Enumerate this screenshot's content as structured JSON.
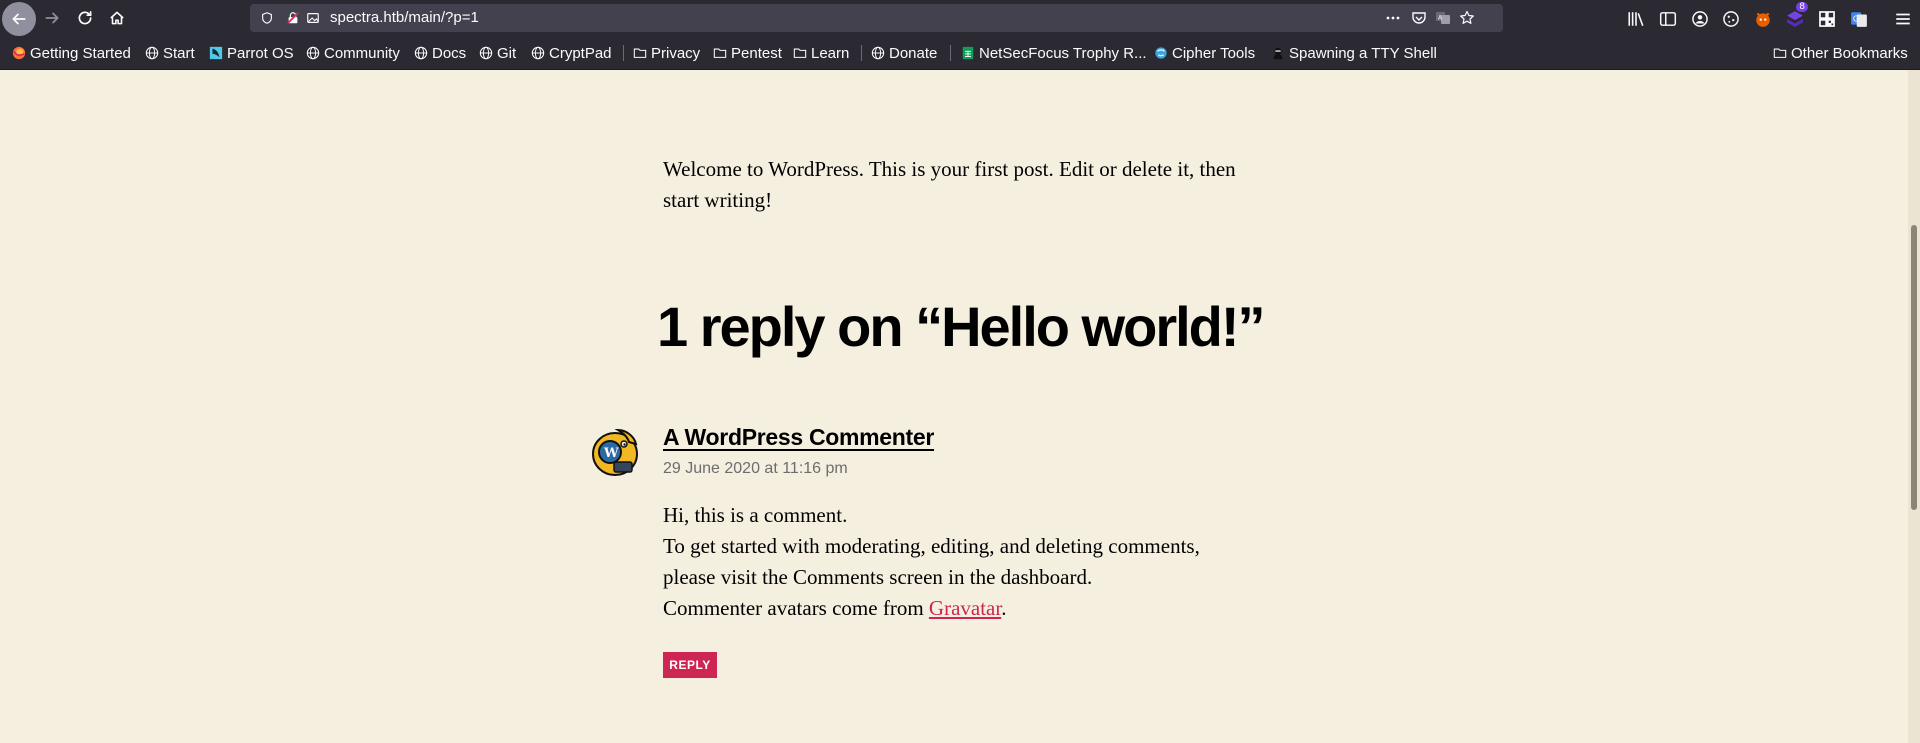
{
  "browser": {
    "url": "spectra.htb/main/?p=1",
    "bookmarks": [
      {
        "label": "Getting Started",
        "icon": "firefox-icon"
      },
      {
        "label": "Start",
        "icon": "globe-icon"
      },
      {
        "label": "Parrot OS",
        "icon": "parrot-icon"
      },
      {
        "label": "Community",
        "icon": "globe-icon"
      },
      {
        "label": "Docs",
        "icon": "globe-icon"
      },
      {
        "label": "Git",
        "icon": "globe-icon"
      },
      {
        "label": "CryptPad",
        "icon": "globe-icon"
      },
      {
        "label": "Privacy",
        "icon": "folder-icon"
      },
      {
        "label": "Pentest",
        "icon": "folder-icon"
      },
      {
        "label": "Learn",
        "icon": "folder-icon"
      },
      {
        "label": "Donate",
        "icon": "globe-icon"
      },
      {
        "label": "NetSecFocus Trophy R...",
        "icon": "sheet-icon"
      },
      {
        "label": "Cipher Tools",
        "icon": "cipher-icon"
      },
      {
        "label": "Spawning a TTY Shell",
        "icon": "ninja-icon"
      }
    ],
    "other_bookmarks": "Other Bookmarks",
    "extension_badge": "8"
  },
  "post": {
    "text_line1": "Welcome to WordPress. This is your first post. Edit or delete it, then",
    "text_line2": "start writing!"
  },
  "comments": {
    "title": "1 reply on “Hello world!”",
    "items": [
      {
        "author": "A WordPress Commenter",
        "date": "29 June 2020 at 11:16 pm",
        "line1": "Hi, this is a comment.",
        "line2": "To get started with moderating, editing, and deleting comments,",
        "line3": "please visit the Comments screen in the dashboard.",
        "line4_prefix": "Commenter avatars come from ",
        "line4_link": "Gravatar",
        "line4_suffix": ".",
        "reply_label": "REPLY"
      }
    ]
  },
  "colors": {
    "page_bg": "#f5efe0",
    "accent": "#cd2653",
    "chrome_bg": "#2b2a33"
  }
}
